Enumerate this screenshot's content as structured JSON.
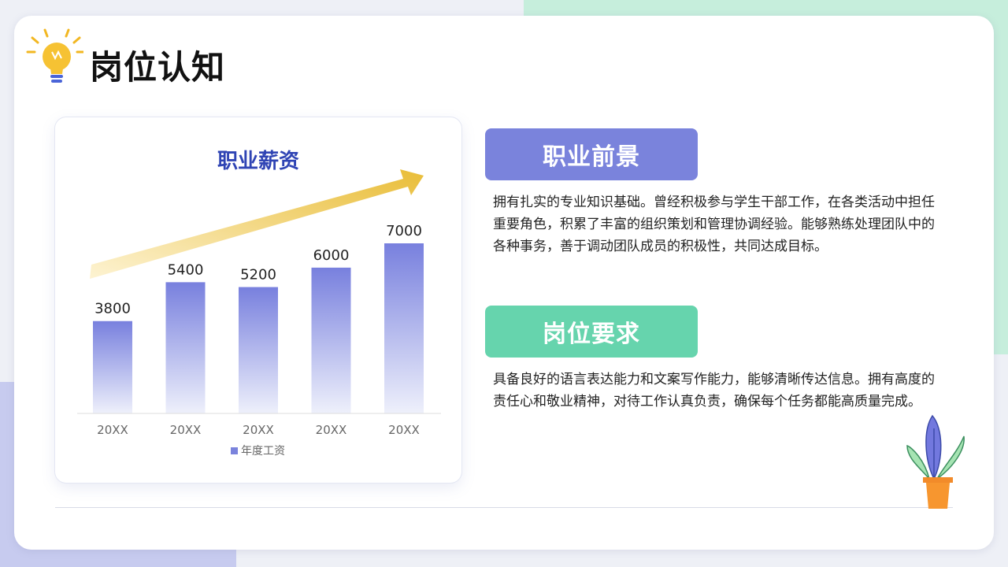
{
  "page": {
    "title": "岗位认知"
  },
  "colors": {
    "accent_purple": "#7a83dc",
    "accent_green": "#66d4ad",
    "chart_title": "#2f44b4",
    "arrow_gold": "#e9bd38"
  },
  "icons": {
    "title_icon": "lightbulb-icon",
    "decoration": "plant-icon"
  },
  "chart_data": {
    "type": "bar",
    "title": "职业薪资",
    "categories": [
      "20XX",
      "20XX",
      "20XX",
      "20XX",
      "20XX"
    ],
    "series": [
      {
        "name": "年度工资",
        "values": [
          3800,
          5400,
          5200,
          6000,
          7000
        ]
      }
    ],
    "ylim": [
      0,
      7000
    ],
    "grid": false,
    "legend": "bottom",
    "data_labels": true
  },
  "sections": [
    {
      "label": "职业前景",
      "text": "拥有扎实的专业知识基础。曾经积极参与学生干部工作，在各类活动中担任重要角色，积累了丰富的组织策划和管理协调经验。能够熟练处理团队中的各种事务，善于调动团队成员的积极性，共同达成目标。"
    },
    {
      "label": "岗位要求",
      "text": "具备良好的语言表达能力和文案写作能力，能够清晰传达信息。拥有高度的责任心和敬业精神，对待工作认真负责，确保每个任务都能高质量完成。"
    }
  ]
}
